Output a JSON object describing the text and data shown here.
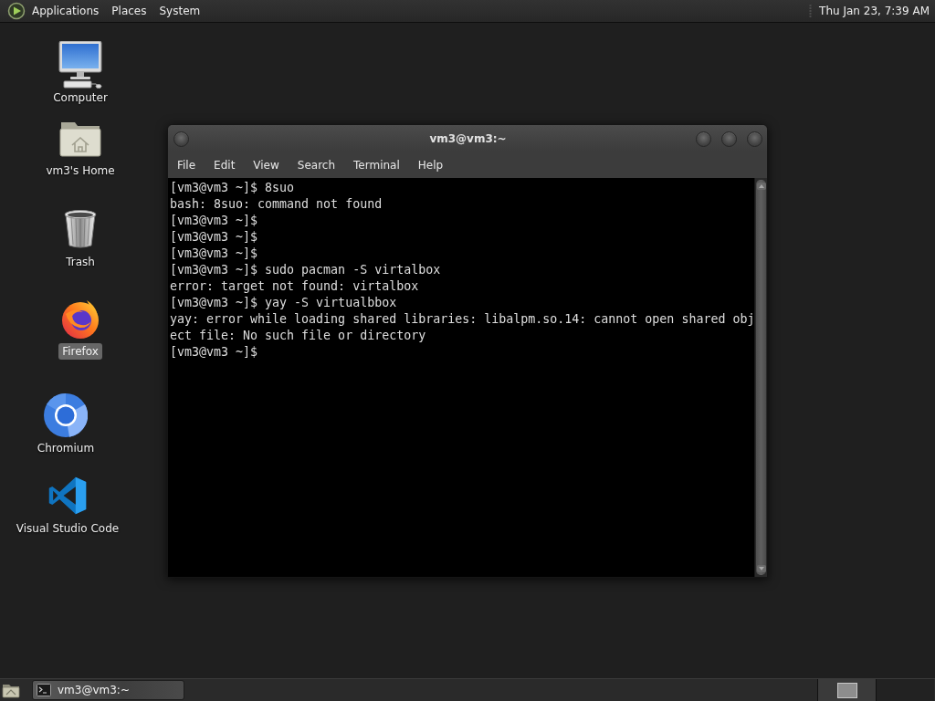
{
  "top_panel": {
    "menus": [
      "Applications",
      "Places",
      "System"
    ],
    "clock": "Thu Jan 23, 7:39 AM"
  },
  "desktop_icons": [
    {
      "label": "Computer",
      "kind": "computer",
      "selected": false
    },
    {
      "label": "vm3's Home",
      "kind": "home",
      "selected": false
    },
    {
      "label": "Trash",
      "kind": "trash",
      "selected": false
    },
    {
      "label": "Firefox",
      "kind": "firefox",
      "selected": true
    },
    {
      "label": "Chromium",
      "kind": "chromium",
      "selected": false
    },
    {
      "label": "Visual Studio Code",
      "kind": "vscode",
      "selected": false
    }
  ],
  "terminal_window": {
    "title": "vm3@vm3:~",
    "menu": [
      "File",
      "Edit",
      "View",
      "Search",
      "Terminal",
      "Help"
    ],
    "lines": [
      "[vm3@vm3 ~]$ 8suo",
      "bash: 8suo: command not found",
      "[vm3@vm3 ~]$",
      "[vm3@vm3 ~]$",
      "[vm3@vm3 ~]$",
      "[vm3@vm3 ~]$ sudo pacman -S virtalbox",
      "error: target not found: virtalbox",
      "[vm3@vm3 ~]$ yay -S virtualbbox",
      "yay: error while loading shared libraries: libalpm.so.14: cannot open shared obj",
      "ect file: No such file or directory",
      "[vm3@vm3 ~]$"
    ]
  },
  "taskbar": {
    "tasks": [
      {
        "label": "vm3@vm3:~",
        "active": true
      }
    ],
    "workspaces": [
      {
        "selected": true,
        "has_window": true
      },
      {
        "selected": false,
        "has_window": false
      }
    ]
  }
}
